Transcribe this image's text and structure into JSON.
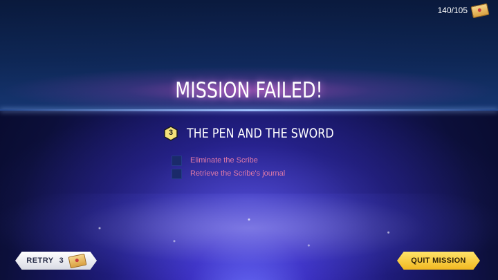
{
  "header": {
    "currency_count": "140/105",
    "currency_icon": "ticket-icon"
  },
  "result": {
    "title": "MISSION FAILED!"
  },
  "mission": {
    "level": "3",
    "name": "THE PEN AND THE SWORD",
    "objectives": [
      {
        "label": "Eliminate the Scribe",
        "completed": false
      },
      {
        "label": "Retrieve the Scribe's journal",
        "completed": false
      }
    ]
  },
  "footer": {
    "retry_label": "RETRY",
    "retry_cost": "3",
    "quit_label": "QUIT MISSION"
  },
  "colors": {
    "accent_gold": "#f1b820",
    "objective_text": "#e07aa8",
    "title_glow": "#d250c8"
  }
}
